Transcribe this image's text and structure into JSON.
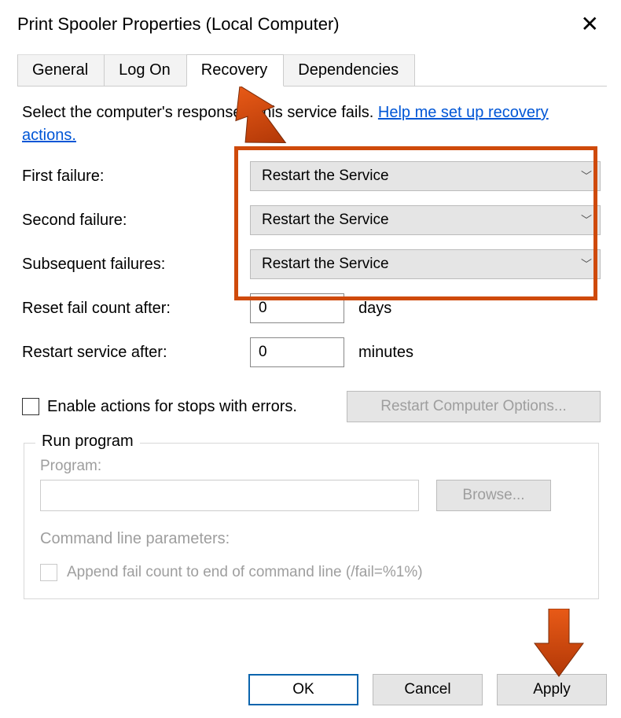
{
  "title": "Print Spooler Properties (Local Computer)",
  "tabs": {
    "general": "General",
    "logon": "Log On",
    "recovery": "Recovery",
    "dependencies": "Dependencies"
  },
  "intro_a": "Select the computer's response if this service fails. ",
  "intro_link": "Help me set up recovery actions.",
  "labels": {
    "first": "First failure:",
    "second": "Second failure:",
    "subsequent": "Subsequent failures:",
    "reset": "Reset fail count after:",
    "restart": "Restart service after:",
    "days": "days",
    "minutes": "minutes",
    "enable": "Enable actions for stops with errors.",
    "restart_opts": "Restart Computer Options...",
    "run_program": "Run program",
    "program": "Program:",
    "browse": "Browse...",
    "cmdline": "Command line parameters:",
    "append": "Append fail count to end of command line (/fail=%1%)"
  },
  "dropdowns": {
    "first": "Restart the Service",
    "second": "Restart the Service",
    "subsequent": "Restart the Service"
  },
  "values": {
    "reset": "0",
    "restart": "0"
  },
  "buttons": {
    "ok": "OK",
    "cancel": "Cancel",
    "apply": "Apply"
  }
}
